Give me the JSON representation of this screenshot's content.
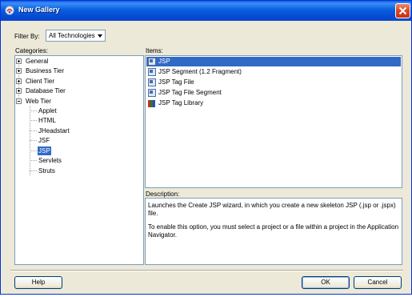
{
  "window": {
    "title": "New Gallery"
  },
  "filter": {
    "label": "Filter By:",
    "value": "All Technologies"
  },
  "categories": {
    "label": "Categories:",
    "items": [
      {
        "label": "General",
        "expander": "plus"
      },
      {
        "label": "Business Tier",
        "expander": "plus"
      },
      {
        "label": "Client Tier",
        "expander": "plus"
      },
      {
        "label": "Database Tier",
        "expander": "plus"
      },
      {
        "label": "Web Tier",
        "expander": "minus"
      }
    ],
    "web_tier_children": [
      "Applet",
      "HTML",
      "JHeadstart",
      "JSF",
      "JSP",
      "Servlets",
      "Struts"
    ],
    "selected": "JSP"
  },
  "items": {
    "label": "Items:",
    "list": [
      {
        "label": "JSP",
        "icon": "jsp-file-icon",
        "selected": true
      },
      {
        "label": "JSP Segment (1.2 Fragment)",
        "icon": "jsp-file-icon",
        "selected": false
      },
      {
        "label": "JSP Tag File",
        "icon": "jsp-file-icon",
        "selected": false
      },
      {
        "label": "JSP Tag File Segment",
        "icon": "jsp-file-icon",
        "selected": false
      },
      {
        "label": "JSP Tag Library",
        "icon": "tag-library-icon",
        "selected": false
      }
    ]
  },
  "description": {
    "label": "Description:",
    "paragraphs": [
      "Launches the Create JSP wizard, in which you create a new skeleton JSP (.jsp or .jspx) file.",
      "To enable this option, you must select a project or a file within a project in the Application Navigator."
    ]
  },
  "buttons": {
    "help": "Help",
    "ok": "OK",
    "cancel": "Cancel"
  },
  "colors": {
    "selection": "#316ac5",
    "titlebar": "#0a5fe0",
    "dialog_bg": "#ece9d8"
  }
}
